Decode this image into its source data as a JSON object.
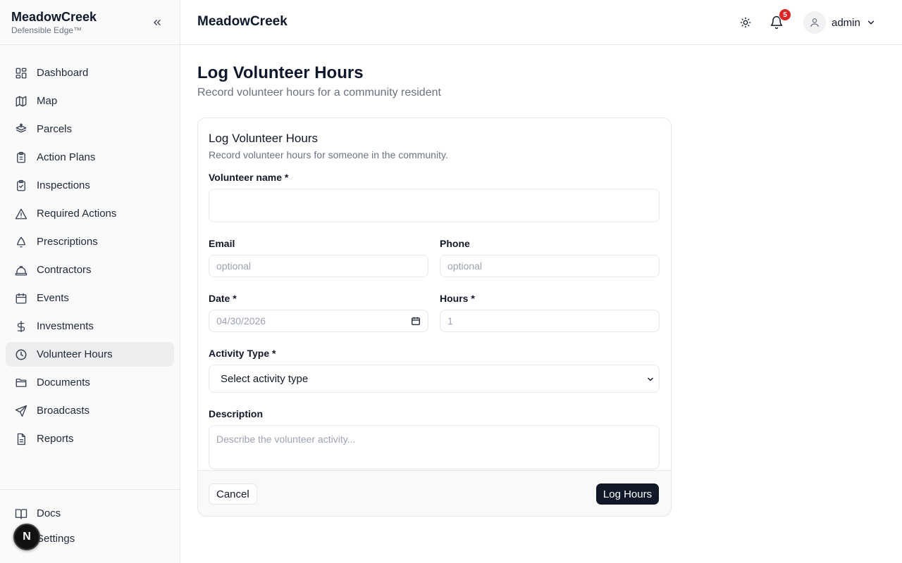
{
  "brand": {
    "name": "MeadowCreek",
    "tagline": "Defensible Edge™"
  },
  "sidebar": {
    "items": [
      {
        "label": "Dashboard",
        "icon": "dashboard-icon"
      },
      {
        "label": "Map",
        "icon": "map-icon"
      },
      {
        "label": "Parcels",
        "icon": "parcels-icon"
      },
      {
        "label": "Action Plans",
        "icon": "clipboard-icon"
      },
      {
        "label": "Inspections",
        "icon": "clipboard-check-icon"
      },
      {
        "label": "Required Actions",
        "icon": "warning-icon"
      },
      {
        "label": "Prescriptions",
        "icon": "cone-icon"
      },
      {
        "label": "Contractors",
        "icon": "hard-hat-icon"
      },
      {
        "label": "Events",
        "icon": "calendar-icon"
      },
      {
        "label": "Investments",
        "icon": "dollar-icon"
      },
      {
        "label": "Volunteer Hours",
        "icon": "clock-icon",
        "active": true
      },
      {
        "label": "Documents",
        "icon": "folder-icon"
      },
      {
        "label": "Broadcasts",
        "icon": "send-icon"
      },
      {
        "label": "Reports",
        "icon": "file-text-icon"
      }
    ],
    "bottom": [
      {
        "label": "Docs",
        "icon": "book-icon"
      },
      {
        "label": "Settings",
        "icon": "settings-icon"
      }
    ],
    "dev_badge": "N"
  },
  "header": {
    "title": "MeadowCreek",
    "notification_count": "5",
    "user": "admin"
  },
  "page": {
    "title": "Log Volunteer Hours",
    "subtitle": "Record volunteer hours for a community resident"
  },
  "form": {
    "title": "Log Volunteer Hours",
    "subtitle": "Record volunteer hours for someone in the community.",
    "volunteer_name": {
      "label": "Volunteer name *",
      "value": ""
    },
    "email": {
      "label": "Email",
      "placeholder": "optional"
    },
    "phone": {
      "label": "Phone",
      "placeholder": "optional"
    },
    "date": {
      "label": "Date *",
      "placeholder": "04/30/2026"
    },
    "hours": {
      "label": "Hours *",
      "placeholder": "1"
    },
    "activity_type": {
      "label": "Activity Type *",
      "selected": "Select activity type"
    },
    "description": {
      "label": "Description",
      "placeholder": "Describe the volunteer activity..."
    },
    "cancel_label": "Cancel",
    "submit_label": "Log Hours"
  },
  "colors": {
    "primary": "#111827",
    "active_nav": "#eeeef0",
    "badge": "#dc2626"
  }
}
